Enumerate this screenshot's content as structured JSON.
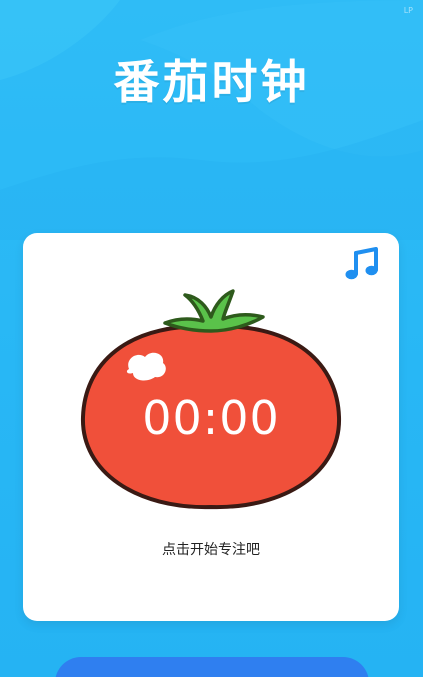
{
  "app": {
    "title": "番茄时钟",
    "corner_mark": "LP"
  },
  "timer": {
    "display": "00:00",
    "hint": "点击开始专注吧"
  },
  "icons": {
    "music": "music-note-icon",
    "tomato": "tomato-icon"
  },
  "colors": {
    "background": "#28b7f5",
    "card": "#ffffff",
    "tomato": "#f0503a",
    "leaf": "#5ac24a",
    "music_icon": "#1f8ff0",
    "start_button": "#2f7ff0"
  }
}
